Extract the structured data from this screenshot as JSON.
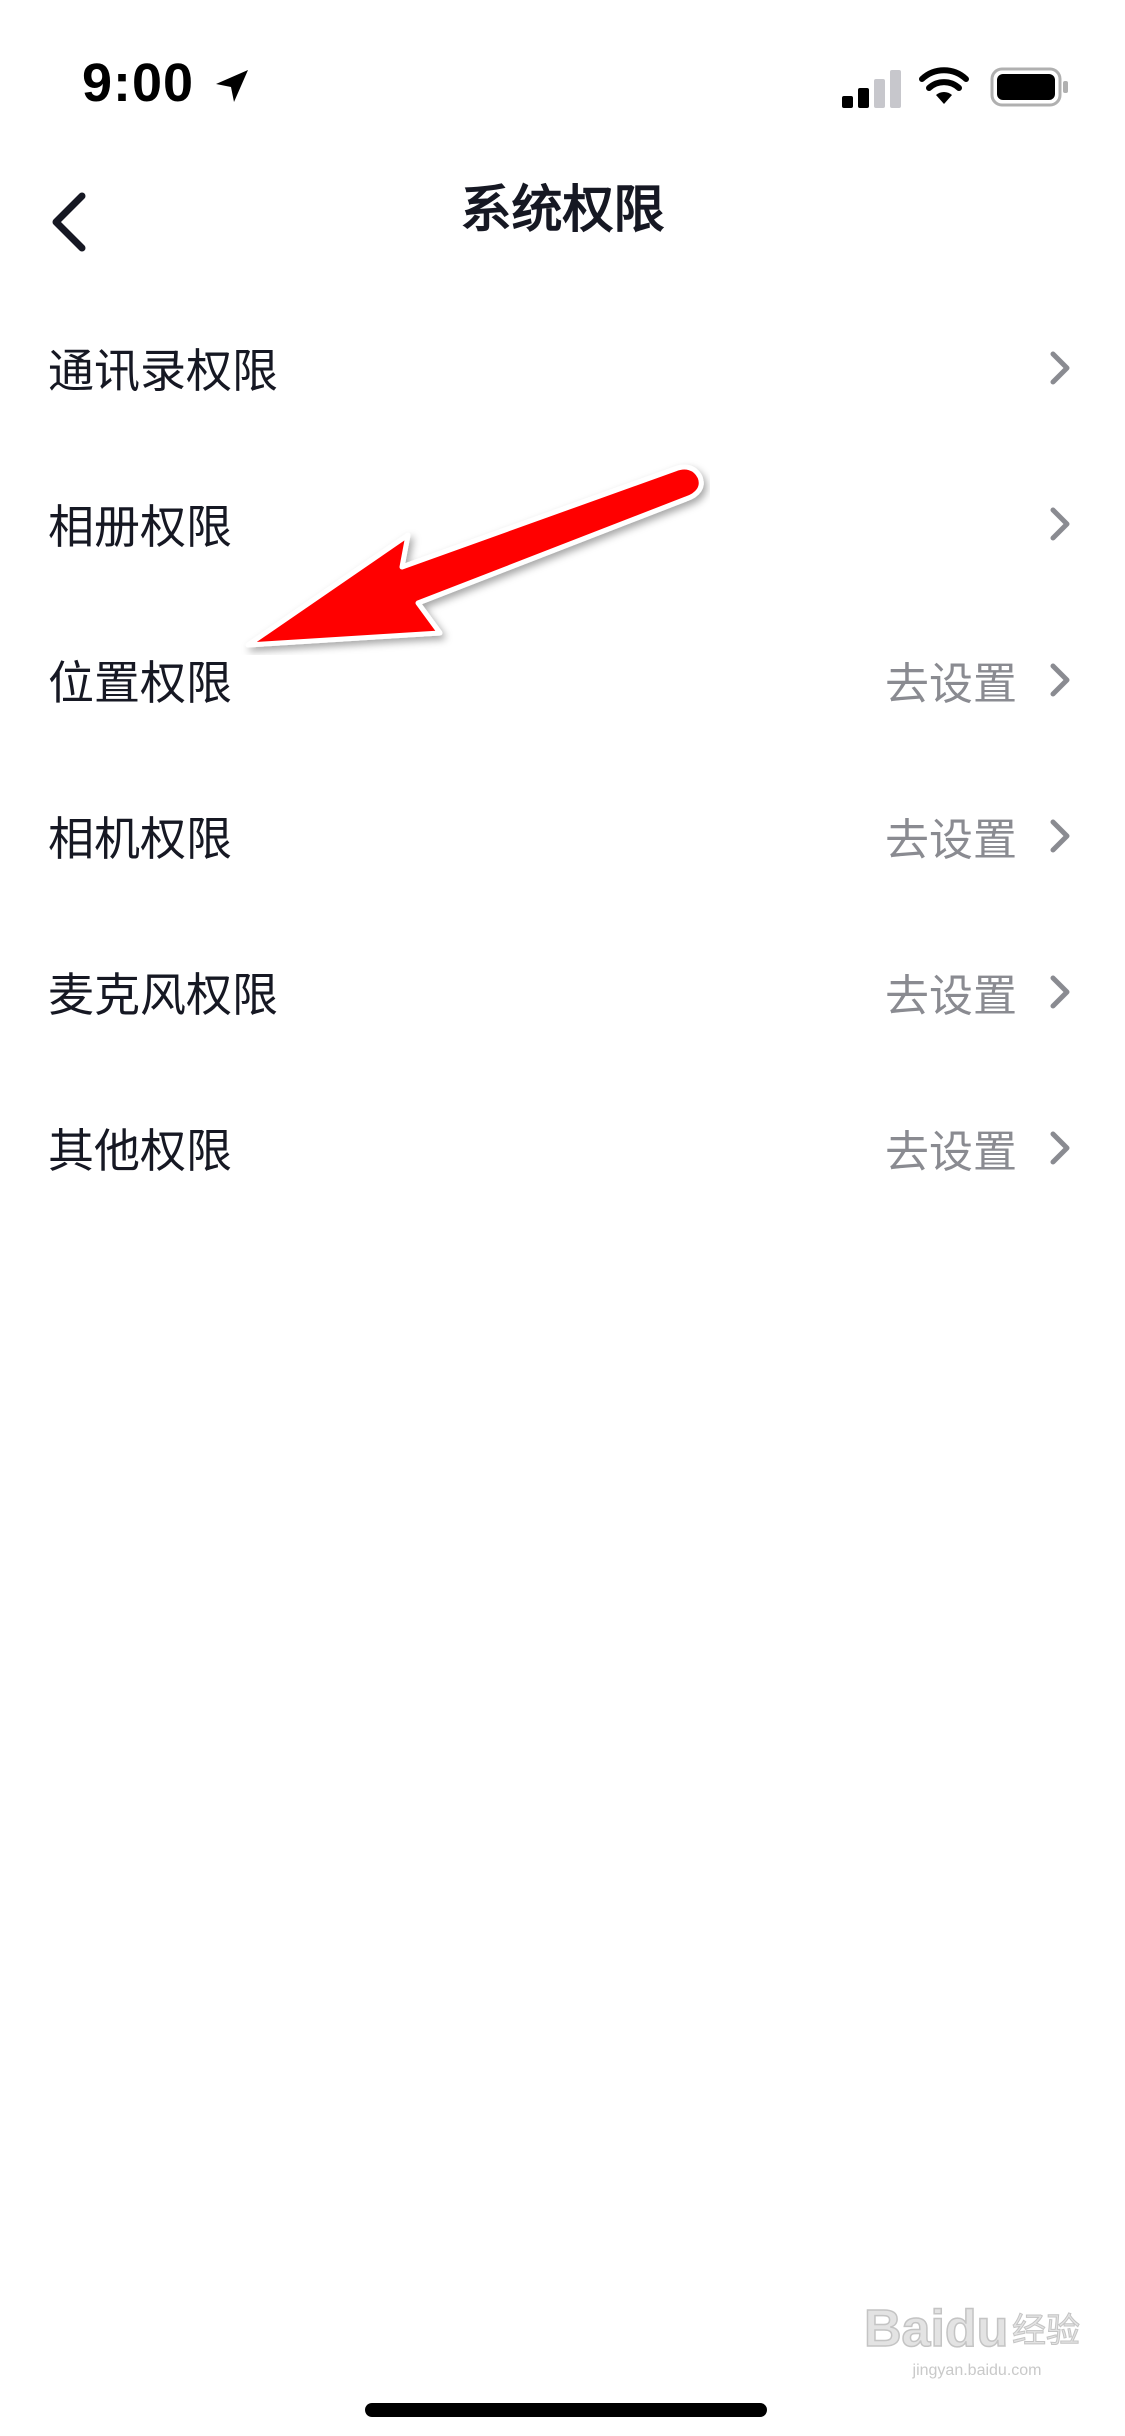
{
  "status_bar": {
    "time": "9:00",
    "icons": [
      "location-arrow-icon",
      "cellular-signal-icon",
      "wifi-icon",
      "battery-icon"
    ]
  },
  "nav": {
    "back_icon": "chevron-left-icon",
    "title": "系统权限"
  },
  "permissions": [
    {
      "label": "通讯录权限",
      "action": ""
    },
    {
      "label": "相册权限",
      "action": ""
    },
    {
      "label": "位置权限",
      "action": "去设置"
    },
    {
      "label": "相机权限",
      "action": "去设置"
    },
    {
      "label": "麦克风权限",
      "action": "去设置"
    },
    {
      "label": "其他权限",
      "action": "去设置"
    }
  ],
  "colors": {
    "annotation_arrow": "#ff0000",
    "secondary_text": "#8a8b91",
    "primary_text": "#161823"
  },
  "watermark": {
    "brand": "Baidu经验",
    "url": "jingyan.baidu.com"
  }
}
